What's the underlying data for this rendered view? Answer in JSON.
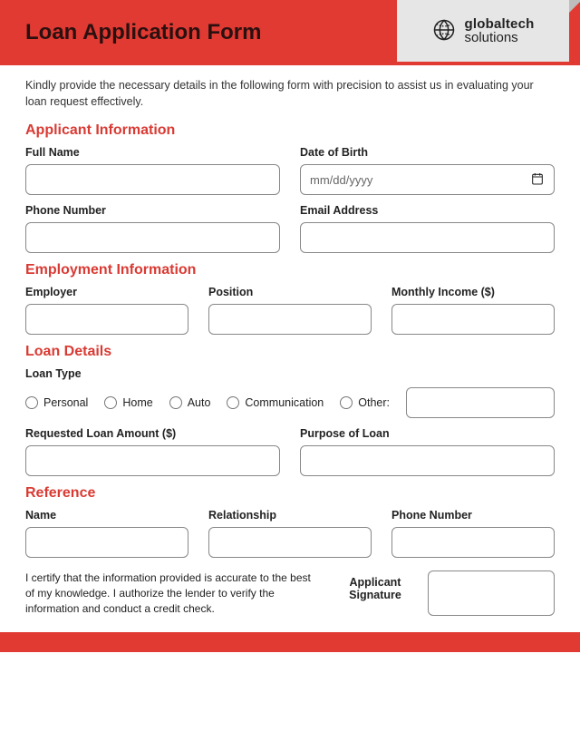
{
  "header": {
    "title": "Loan Application Form"
  },
  "brand": {
    "line1": "globaltech",
    "line2": "solutions"
  },
  "intro": "Kindly provide the necessary details in the following form with precision to assist us in evaluating your loan request effectively.",
  "sections": {
    "applicant": {
      "title": "Applicant Information",
      "full_name": "Full Name",
      "dob": "Date of Birth",
      "dob_placeholder": "mm/dd/yyyy",
      "phone": "Phone Number",
      "email": "Email Address"
    },
    "employment": {
      "title": "Employment Information",
      "employer": "Employer",
      "position": "Position",
      "income": "Monthly Income ($)"
    },
    "loan": {
      "title": "Loan Details",
      "type_label": "Loan Type",
      "types": {
        "personal": "Personal",
        "home": "Home",
        "auto": "Auto",
        "communication": "Communication",
        "other": "Other:"
      },
      "amount": "Requested Loan Amount ($)",
      "purpose": "Purpose of Loan"
    },
    "reference": {
      "title": "Reference",
      "name": "Name",
      "relationship": "Relationship",
      "phone": "Phone Number"
    }
  },
  "certification": "I certify that the information provided is accurate to the best of my knowledge. I authorize the lender to verify the information and conduct a credit check.",
  "signature_label": "Applicant\nSignature"
}
